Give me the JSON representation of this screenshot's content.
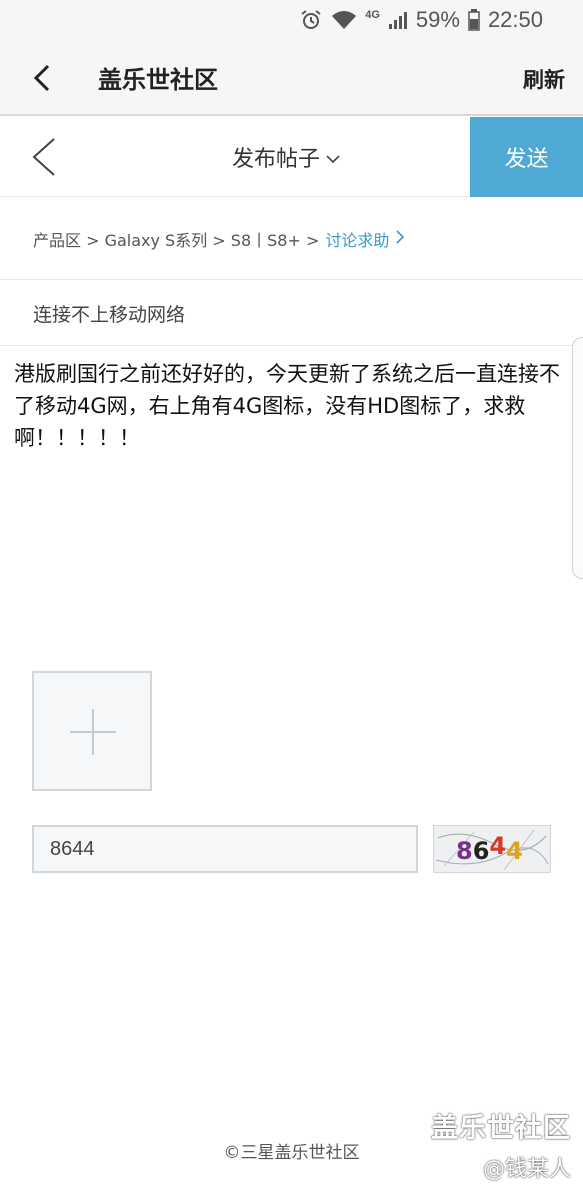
{
  "status_bar": {
    "network": "4G",
    "battery": "59%",
    "time": "22:50"
  },
  "app_bar": {
    "title": "盖乐世社区",
    "refresh_label": "刷新"
  },
  "post_bar": {
    "title": "发布帖子",
    "send_label": "发送"
  },
  "breadcrumb": {
    "path": "产品区 > Galaxy S系列 > S8丨S8+ >",
    "current": "讨论求助"
  },
  "post": {
    "subject": "连接不上移动网络",
    "body": "港版刷国行之前还好好的，今天更新了系统之后一直连接不了移动4G网，右上角有4G图标，没有HD图标了，求救啊！！！！！"
  },
  "captcha": {
    "input_value": "8644",
    "image_text": "8644"
  },
  "footer": {
    "copyright": "©三星盖乐世社区"
  },
  "watermark": {
    "line1": "盖乐世社区",
    "line2": "@钱某人"
  },
  "colors": {
    "send_bg": "#4fa9d4",
    "link": "#3b9ac9"
  }
}
